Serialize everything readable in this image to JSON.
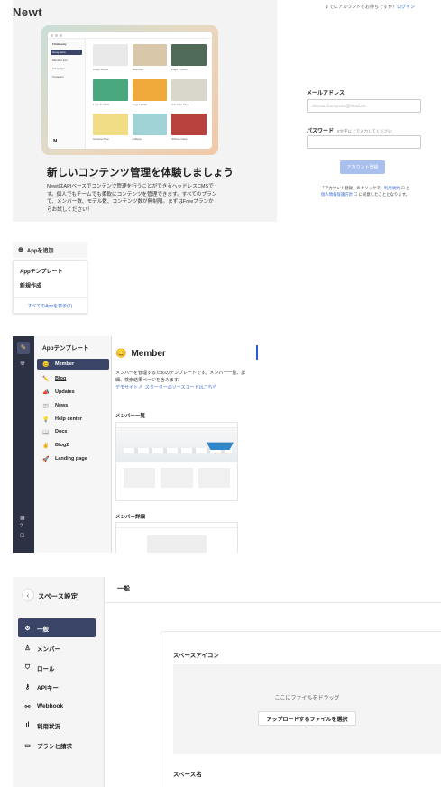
{
  "signup": {
    "logo": "Newt",
    "top_hint": "すでにアカウントをお持ちですか？",
    "top_hint_link": "ログイン",
    "mock": {
      "sidebar_title": "FitnBeauty",
      "sidebar_items": [
        "Goog store",
        "Member info",
        "Campaign",
        "Company"
      ],
      "tiles": [
        "Crazy Stools",
        "Ship Cup",
        "Logo T-shirts",
        "Logo Tumbler",
        "Logo Lighter",
        "Cassette Tape",
        "Camera Trap",
        "Lollipop",
        "iPhone Case"
      ]
    },
    "heading": "新しいコンテンツ管理を体験しましょう",
    "description": "NewtはAPIベースでコンテンツ管理を行うことができるヘッドレスCMSです。個人でもチームでも柔軟にコンテンツを管理できます。すべてのプランで、メンバー数、モデル数、コンテンツ数が無制限。まずはFreeプランからお試しください！",
    "email_label": "メールアドレス",
    "email_placeholder": "donna.thompson@newt.so",
    "password_label": "パスワード",
    "password_note": "8文字以上で入力してください",
    "submit_label": "アカウント登録",
    "terms_prefix": "「アカウント登録」のクリックで、",
    "terms_link1": "利用規約",
    "terms_mid": "と",
    "terms_link2": "個人情報保護方針",
    "terms_suffix": "に同意したこととなります。"
  },
  "add_app": {
    "button_label": "Appを追加",
    "items": [
      "Appテンプレート",
      "新規作成"
    ],
    "footer_link": "すべてのAppを表示(1)"
  },
  "templates": {
    "list_title": "Appテンプレート",
    "items": [
      {
        "icon": "😊",
        "label": "Member"
      },
      {
        "icon": "✏️",
        "label": "Blog"
      },
      {
        "icon": "📣",
        "label": "Updates"
      },
      {
        "icon": "📰",
        "label": "News"
      },
      {
        "icon": "💡",
        "label": "Help center"
      },
      {
        "icon": "📖",
        "label": "Docs"
      },
      {
        "icon": "✌️",
        "label": "Blog2"
      },
      {
        "icon": "🚀",
        "label": "Landing page"
      }
    ],
    "detail": {
      "icon": "😊",
      "title": "Member",
      "description": "メンバーを管理するためのテンプレートです。メンバー一覧、詳細、検索結果ページを含みます。",
      "link1": "デモサイト↗",
      "link2": "スターターのソースコードはこちら",
      "section1": "メンバー一覧",
      "section2": "メンバー詳細"
    }
  },
  "space_settings": {
    "title": "スペース設定",
    "menu": [
      {
        "icon": "gear-icon",
        "label": "一般"
      },
      {
        "icon": "user-icon",
        "label": "メンバー"
      },
      {
        "icon": "shield-icon",
        "label": "ロール"
      },
      {
        "icon": "key-icon",
        "label": "APIキー"
      },
      {
        "icon": "webhook-icon",
        "label": "Webhook"
      },
      {
        "icon": "bar-chart-icon",
        "label": "利用状況"
      },
      {
        "icon": "card-icon",
        "label": "プランと請求"
      }
    ],
    "header": "一般",
    "icon_section": "スペースアイコン",
    "drop_text": "ここにファイルをドラッグ",
    "upload_button": "アップロードするファイルを選択",
    "name_section": "スペース名"
  },
  "colors": {
    "accent": "#3a4466",
    "link": "#3b6ed6",
    "button_disabled": "#a9c0ef"
  }
}
